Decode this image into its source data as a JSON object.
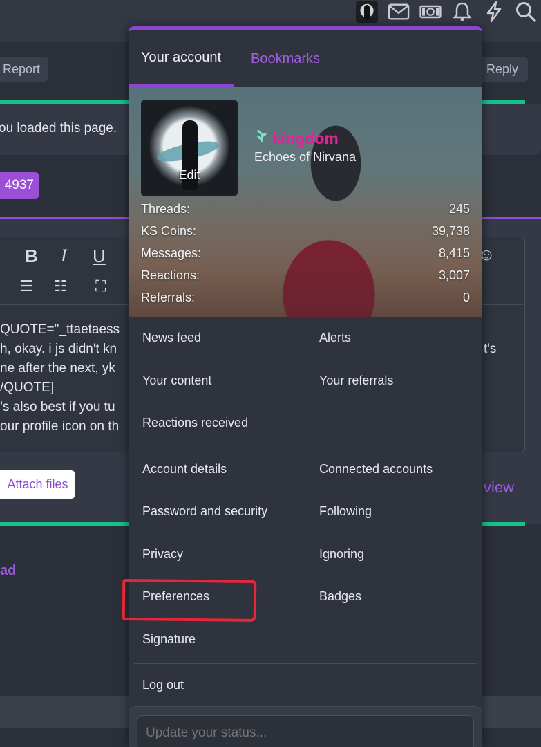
{
  "topbar": {
    "icons": [
      "avatar",
      "envelope-icon",
      "money-icon",
      "bell-icon",
      "bolt-icon",
      "search-icon"
    ]
  },
  "background": {
    "report_label": "Report",
    "reply_label": "Reply",
    "notice_text": "ou loaded this page.",
    "tag_text": "4937",
    "editor_lines": [
      "QUOTE=\"_ttaetaess",
      "h, okay. i js didn't kn",
      "ne after the next, yk",
      "/QUOTE]",
      "’s also best if you tu",
      "our profile icon on th"
    ],
    "editor_right_fragment": "t's",
    "attach_label": "Attach files",
    "preview_fragment": "view",
    "thread_fragment": "ad"
  },
  "menu": {
    "tabs": [
      {
        "label": "Your account"
      },
      {
        "label": "Bookmarks"
      }
    ],
    "profile": {
      "avatar_edit": "Edit",
      "username": "kingdom",
      "user_title": "Echoes of Nirvana",
      "stats": [
        {
          "label": "Threads:",
          "value": "245"
        },
        {
          "label": "KS Coins:",
          "value": "39,738"
        },
        {
          "label": "Messages:",
          "value": "8,415"
        },
        {
          "label": "Reactions:",
          "value": "3,007"
        },
        {
          "label": "Referrals:",
          "value": "0"
        }
      ]
    },
    "group1": [
      "News feed",
      "Alerts",
      "Your content",
      "Your referrals",
      "Reactions received"
    ],
    "group2": [
      "Account details",
      "Connected accounts",
      "Password and security",
      "Following",
      "Privacy",
      "Ignoring",
      "Preferences",
      "Badges",
      "Signature"
    ],
    "logout": "Log out",
    "status_placeholder": "Update your status..."
  },
  "colors": {
    "accent_purple": "#8b45cf",
    "link_purple": "#a55ee6",
    "username_pink": "#e0239a",
    "green": "#14c28a",
    "annotation_red": "#e8263a"
  }
}
